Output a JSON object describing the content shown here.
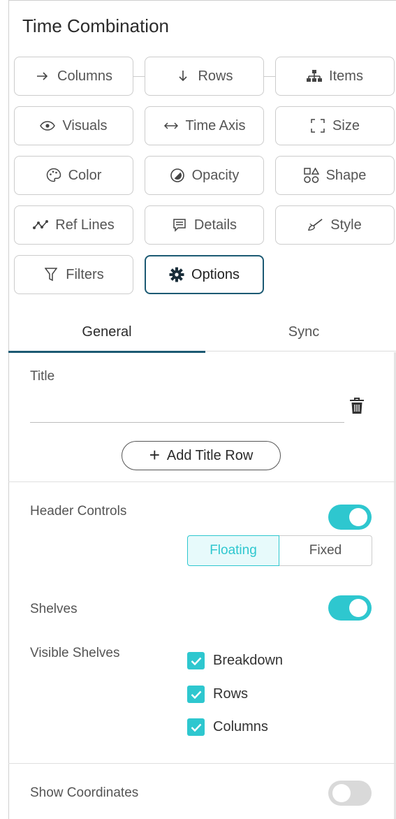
{
  "panel": {
    "title": "Time Combination"
  },
  "buttons": {
    "columns": "Columns",
    "rows": "Rows",
    "items": "Items",
    "visuals": "Visuals",
    "time_axis": "Time Axis",
    "size": "Size",
    "color": "Color",
    "opacity": "Opacity",
    "shape": "Shape",
    "ref_lines": "Ref Lines",
    "details": "Details",
    "style": "Style",
    "filters": "Filters",
    "options": "Options"
  },
  "tabs": {
    "general": "General",
    "sync": "Sync",
    "selected": "General"
  },
  "general": {
    "title_label": "Title",
    "title_value": "",
    "add_title_row": "Add Title Row",
    "header_controls": {
      "label": "Header Controls",
      "on": true,
      "options": [
        "Floating",
        "Fixed"
      ],
      "selected": "Floating"
    },
    "shelves": {
      "label": "Shelves",
      "on": true
    },
    "visible_shelves": {
      "label": "Visible Shelves",
      "items": [
        {
          "label": "Breakdown",
          "checked": true
        },
        {
          "label": "Rows",
          "checked": true
        },
        {
          "label": "Columns",
          "checked": true
        }
      ]
    },
    "show_coordinates": {
      "label": "Show Coordinates",
      "on": false
    }
  },
  "colors": {
    "accent": "#2ec7cf",
    "active_border": "#1c5a73"
  }
}
